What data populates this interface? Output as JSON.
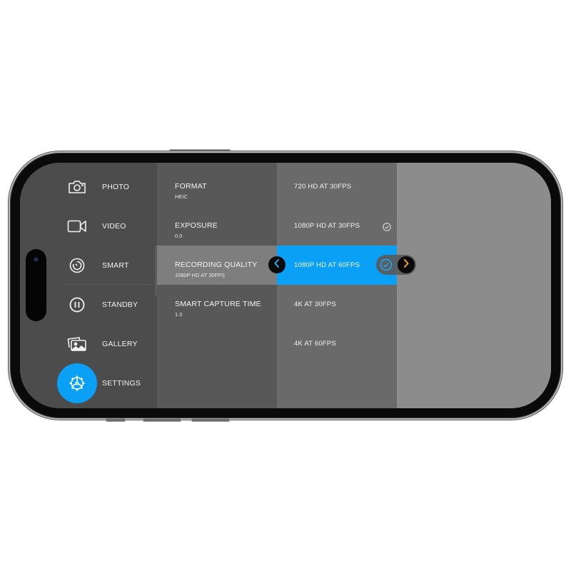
{
  "nav": {
    "items": [
      {
        "label": "PHOTO",
        "icon": "camera-icon"
      },
      {
        "label": "VIDEO",
        "icon": "video-camera-icon"
      },
      {
        "label": "SMART",
        "icon": "smart-timer-icon"
      },
      {
        "label": "STANDBY",
        "icon": "pause-icon"
      },
      {
        "label": "GALLERY",
        "icon": "gallery-icon"
      },
      {
        "label": "SETTINGS",
        "icon": "gear-icon"
      }
    ],
    "active": "SETTINGS",
    "accent_color": "#0aa0f5"
  },
  "settings": {
    "items": [
      {
        "title": "FORMAT",
        "value": "HEIC"
      },
      {
        "title": "EXPOSURE",
        "value": "0.0"
      },
      {
        "title": "RECORDING QUALITY",
        "value": "1080P HD AT 30FPS"
      },
      {
        "title": "SMART CAPTURE TIME",
        "value": "1.0"
      }
    ],
    "active": "RECORDING QUALITY"
  },
  "options": {
    "items": [
      {
        "label": "720 HD AT 30FPS"
      },
      {
        "label": "1080P HD AT 30FPS",
        "current": true
      },
      {
        "label": "1080P HD AT 60FPS",
        "highlighted": true
      },
      {
        "label": "4K AT 30FPS"
      },
      {
        "label": "4K AT 60FPS"
      }
    ],
    "highlight_color": "#0aa0f5"
  },
  "controls": {
    "back_icon": "chevron-left-icon",
    "confirm_icon": "check-circle-icon",
    "next_icon": "chevron-right-icon",
    "next_color": "#f0a030"
  }
}
